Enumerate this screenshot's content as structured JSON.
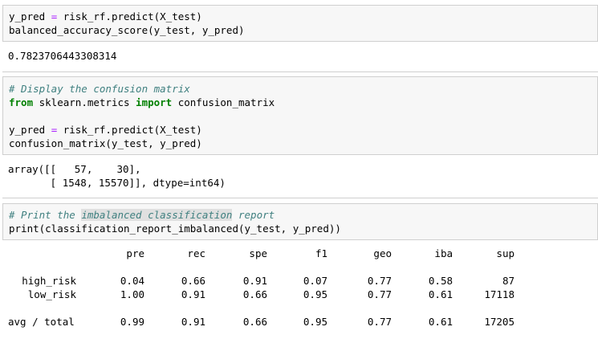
{
  "cell1": {
    "line1": [
      "y_pred ",
      "=",
      " risk_rf.predict(X_test)"
    ],
    "line2": "balanced_accuracy_score(y_test, y_pred)",
    "output": "0.7823706443308314"
  },
  "cell2": {
    "comment": "# Display the confusion matrix",
    "import_line": [
      "from",
      " sklearn.metrics ",
      "import",
      " confusion_matrix"
    ],
    "line3": [
      "y_pred ",
      "=",
      " risk_rf.predict(X_test)"
    ],
    "line4": "confusion_matrix(y_test, y_pred)",
    "output_line1": "array([[   57,    30],",
    "output_line2": "       [ 1548, 15570]], dtype=int64)"
  },
  "cell3": {
    "comment_parts": [
      "# Print the ",
      "imbalanced classification",
      " report"
    ],
    "line2": "print(classification_report_imbalanced(y_test, y_pred))"
  },
  "report": {
    "headers": [
      "pre",
      "rec",
      "spe",
      "f1",
      "geo",
      "iba",
      "sup"
    ],
    "rows": [
      {
        "label": "high_risk",
        "values": [
          "0.04",
          "0.66",
          "0.91",
          "0.07",
          "0.77",
          "0.58",
          "87"
        ]
      },
      {
        "label": "low_risk",
        "values": [
          "1.00",
          "0.91",
          "0.66",
          "0.95",
          "0.77",
          "0.61",
          "17118"
        ]
      },
      {
        "label": "avg / total",
        "values": [
          "0.99",
          "0.91",
          "0.66",
          "0.95",
          "0.77",
          "0.61",
          "17205"
        ]
      }
    ]
  }
}
